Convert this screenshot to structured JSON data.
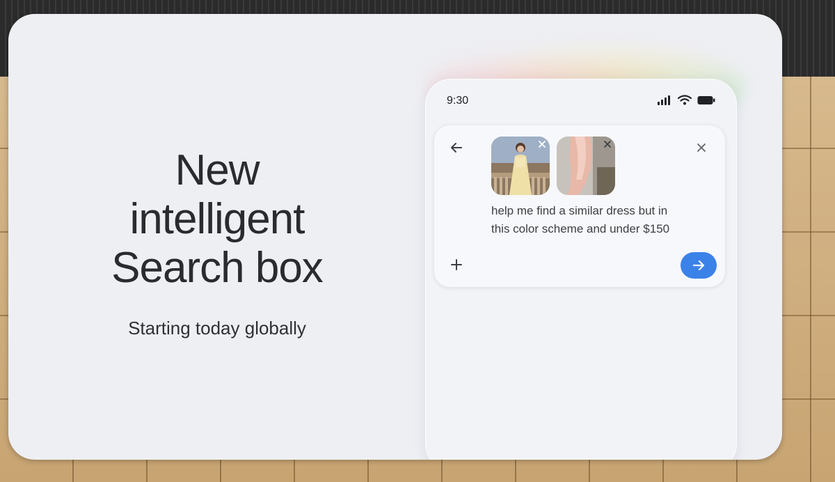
{
  "slide": {
    "headline_lines": [
      "New",
      "intelligent",
      "Search box"
    ],
    "subline": "Starting today globally"
  },
  "phone": {
    "status": {
      "time": "9:30",
      "icons": [
        "signal-icon",
        "wifi-icon",
        "battery-icon"
      ]
    },
    "search_box": {
      "attachments": [
        {
          "name": "dress-photo",
          "remove_icon": "close-icon"
        },
        {
          "name": "fabric-swatch-photo",
          "remove_icon": "close-icon"
        }
      ],
      "query_lines": [
        "help me find a similar dress but in",
        "this color scheme and under $150"
      ],
      "icons": {
        "back": "arrow-left-icon",
        "close": "close-icon",
        "add": "plus-icon",
        "send": "arrow-right-icon"
      },
      "send_color": "#3b82e8"
    }
  }
}
